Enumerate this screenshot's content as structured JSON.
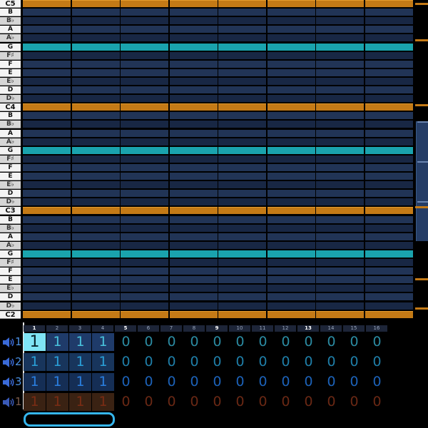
{
  "piano_roll": {
    "note_labels": [
      "C5",
      "B",
      "B♭",
      "A",
      "A♭",
      "G",
      "F♯",
      "F",
      "E",
      "E♭",
      "D",
      "D♭",
      "C4",
      "B",
      "B♭",
      "A",
      "A♭",
      "G",
      "F♯",
      "F",
      "E",
      "E♭",
      "D",
      "D♭",
      "C3",
      "B",
      "B♭",
      "A",
      "A♭",
      "G",
      "F♯",
      "F",
      "E",
      "E♭",
      "D",
      "D♭",
      "C2"
    ],
    "black_keys": [
      2,
      4,
      6,
      9,
      11,
      14,
      16,
      18,
      21,
      23,
      26,
      28,
      30,
      33,
      35
    ],
    "root_rows": [
      0,
      12,
      24,
      36
    ],
    "fifth_rows": [
      5,
      17,
      29
    ],
    "measures": 8,
    "colors": {
      "root_lane": "#c47a16",
      "fifth_lane": "#1aa3ad",
      "lane": "#213456",
      "scrollbar_marker": "#c47a16"
    },
    "scroll_position": 0.5
  },
  "sequencer": {
    "step_numbers": [
      "1",
      "2",
      "3",
      "4",
      "5",
      "6",
      "7",
      "8",
      "9",
      "10",
      "11",
      "12",
      "13",
      "14",
      "15",
      "16"
    ],
    "beat_steps": [
      0,
      4,
      8,
      12
    ],
    "tracks": [
      {
        "label": "1",
        "icon": "speaker-icon",
        "steps": [
          "1",
          "1",
          "1",
          "1",
          "0",
          "0",
          "0",
          "0",
          "0",
          "0",
          "0",
          "0",
          "0",
          "0",
          "0",
          "0"
        ]
      },
      {
        "label": "2",
        "icon": "speaker-icon",
        "steps": [
          "1",
          "1",
          "1",
          "1",
          "0",
          "0",
          "0",
          "0",
          "0",
          "0",
          "0",
          "0",
          "0",
          "0",
          "0",
          "0"
        ]
      },
      {
        "label": "3",
        "icon": "speaker-icon",
        "steps": [
          "1",
          "1",
          "1",
          "1",
          "0",
          "0",
          "0",
          "0",
          "0",
          "0",
          "0",
          "0",
          "0",
          "0",
          "0",
          "0"
        ]
      },
      {
        "label": "1",
        "icon": "speaker-icon",
        "steps": [
          "1",
          "1",
          "1",
          "1",
          "0",
          "0",
          "0",
          "0",
          "0",
          "0",
          "0",
          "0",
          "0",
          "0",
          "0",
          "0"
        ]
      }
    ],
    "selected_step": {
      "track": 0,
      "step": 0
    },
    "colors": {
      "track_1": "#49c3dd",
      "track_2": "#2aa0d8",
      "track_3": "#2a7fe0",
      "track_4": "#7a2c14",
      "selection": "#7fe4f5",
      "pattern_bar": "#35b6ee"
    }
  }
}
